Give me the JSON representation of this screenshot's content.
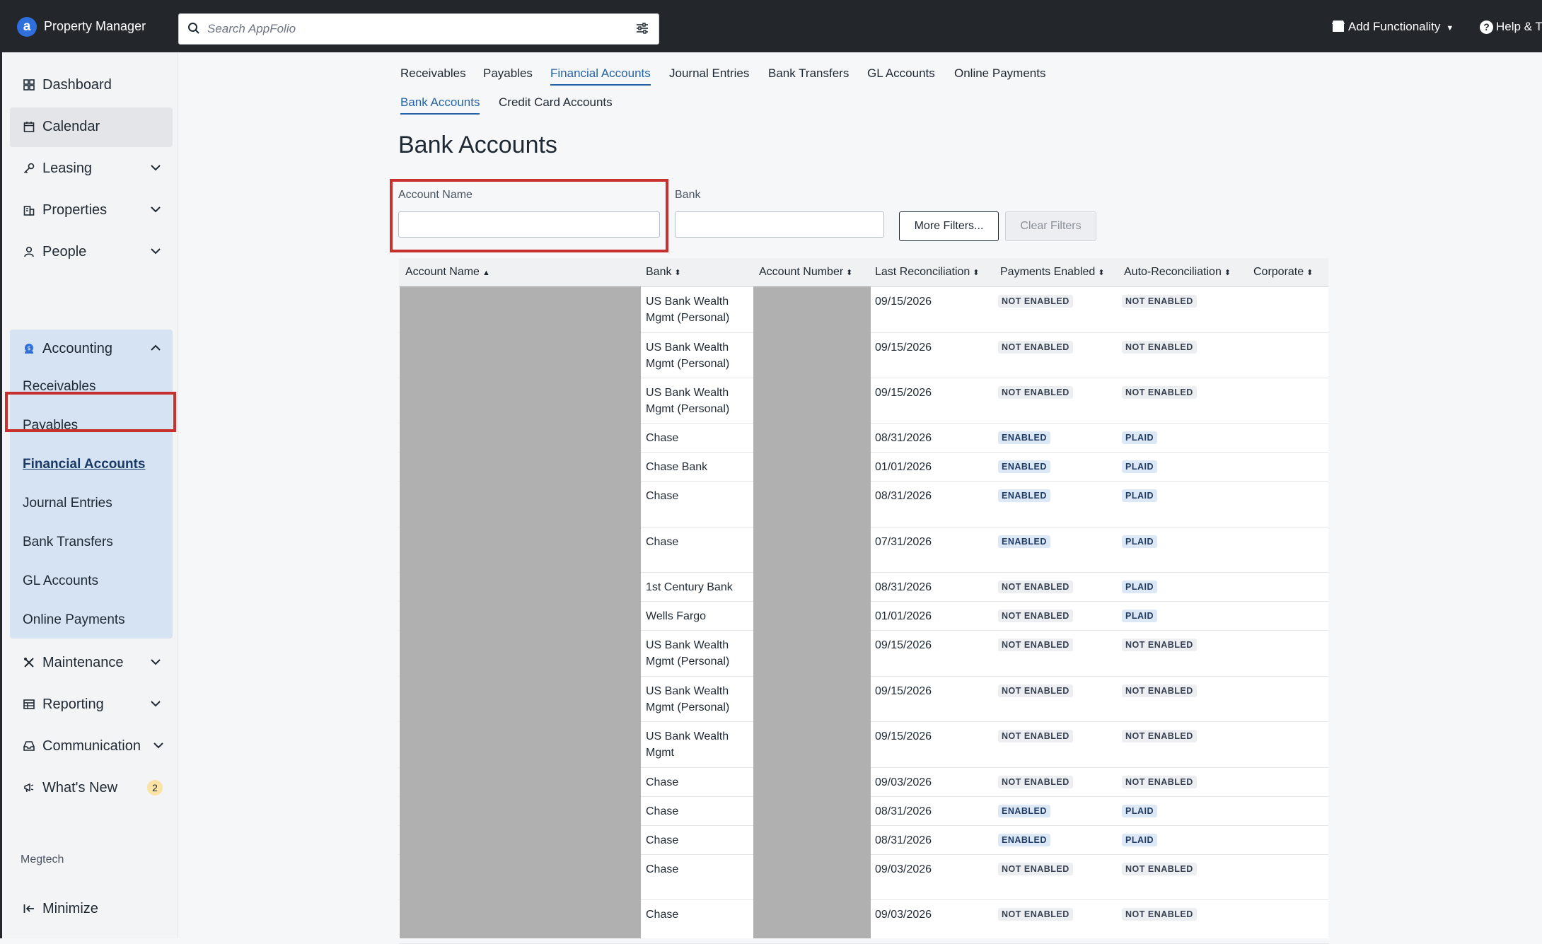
{
  "app": {
    "logo_letter": "a",
    "name": "Property Manager"
  },
  "search": {
    "placeholder": "Search AppFolio"
  },
  "topbar": {
    "add_functionality": "Add Functionality",
    "help": "Help & T"
  },
  "sidebar": {
    "dashboard": "Dashboard",
    "calendar": "Calendar",
    "leasing": "Leasing",
    "properties": "Properties",
    "people": "People",
    "accounting": "Accounting",
    "accounting_items": [
      "Receivables",
      "Payables",
      "Financial Accounts",
      "Journal Entries",
      "Bank Transfers",
      "GL Accounts",
      "Online Payments"
    ],
    "maintenance": "Maintenance",
    "reporting": "Reporting",
    "communication": "Communication",
    "whats_new": "What's New",
    "whats_new_count": "2",
    "company": "Megtech",
    "minimize": "Minimize"
  },
  "tabs": [
    "Receivables",
    "Payables",
    "Financial Accounts",
    "Journal Entries",
    "Bank Transfers",
    "GL Accounts",
    "Online Payments"
  ],
  "subtabs": [
    "Bank Accounts",
    "Credit Card Accounts"
  ],
  "page_title": "Bank Accounts",
  "filters": {
    "account_name_label": "Account Name",
    "account_name_value": "",
    "bank_label": "Bank",
    "bank_value": "",
    "more_filters": "More Filters...",
    "clear_filters": "Clear Filters"
  },
  "table": {
    "columns": [
      "Account Name",
      "Bank",
      "Account Number",
      "Last Reconciliation",
      "Payments Enabled",
      "Auto-Reconciliation",
      "Corporate"
    ],
    "rows": [
      {
        "bank": "US Bank Wealth Mgmt (Personal)",
        "rec": "09/15/2026",
        "pay": "NOT ENABLED",
        "auto": "NOT ENABLED"
      },
      {
        "bank": "US Bank Wealth Mgmt (Personal)",
        "rec": "09/15/2026",
        "pay": "NOT ENABLED",
        "auto": "NOT ENABLED"
      },
      {
        "bank": "US Bank Wealth Mgmt (Personal)",
        "rec": "09/15/2026",
        "pay": "NOT ENABLED",
        "auto": "NOT ENABLED"
      },
      {
        "bank": "Chase",
        "rec": "08/31/2026",
        "pay": "ENABLED",
        "auto": "PLAID"
      },
      {
        "bank": "Chase Bank",
        "rec": "01/01/2026",
        "pay": "ENABLED",
        "auto": "PLAID"
      },
      {
        "bank": "Chase",
        "rec": "08/31/2026",
        "pay": "ENABLED",
        "auto": "PLAID"
      },
      {
        "bank": "Chase",
        "rec": "07/31/2026",
        "pay": "ENABLED",
        "auto": "PLAID"
      },
      {
        "bank": "1st Century Bank",
        "rec": "08/31/2026",
        "pay": "NOT ENABLED",
        "auto": "PLAID"
      },
      {
        "bank": "Wells Fargo",
        "rec": "01/01/2026",
        "pay": "NOT ENABLED",
        "auto": "PLAID"
      },
      {
        "bank": "US Bank Wealth Mgmt (Personal)",
        "rec": "09/15/2026",
        "pay": "NOT ENABLED",
        "auto": "NOT ENABLED"
      },
      {
        "bank": "US Bank Wealth Mgmt (Personal)",
        "rec": "09/15/2026",
        "pay": "NOT ENABLED",
        "auto": "NOT ENABLED"
      },
      {
        "bank": "US Bank Wealth Mgmt",
        "rec": "09/15/2026",
        "pay": "NOT ENABLED",
        "auto": "NOT ENABLED"
      },
      {
        "bank": "Chase",
        "rec": "09/03/2026",
        "pay": "NOT ENABLED",
        "auto": "NOT ENABLED"
      },
      {
        "bank": "Chase",
        "rec": "08/31/2026",
        "pay": "ENABLED",
        "auto": "PLAID"
      },
      {
        "bank": "Chase",
        "rec": "08/31/2026",
        "pay": "ENABLED",
        "auto": "PLAID"
      },
      {
        "bank": "Chase",
        "rec": "09/03/2026",
        "pay": "NOT ENABLED",
        "auto": "NOT ENABLED"
      },
      {
        "bank": "Chase",
        "rec": "09/03/2026",
        "pay": "NOT ENABLED",
        "auto": "NOT ENABLED"
      }
    ]
  },
  "colors": {
    "topbar": "#23262b",
    "accent": "#2563a8",
    "highlight": "#c8302e",
    "accounting_bg": "#d5e3f3"
  }
}
